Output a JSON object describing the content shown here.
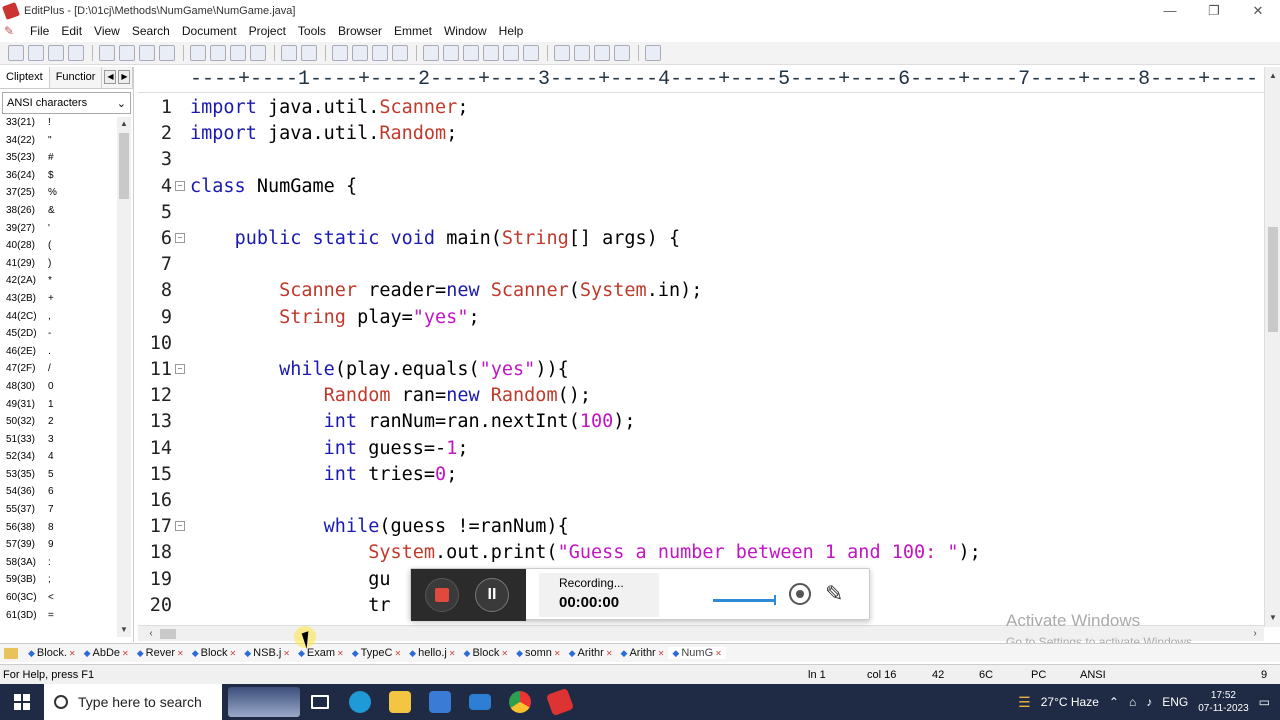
{
  "window": {
    "title": "EditPlus - [D:\\01cj\\Methods\\NumGame\\NumGame.java]",
    "min": "—",
    "max": "❐",
    "close": "✕"
  },
  "menu": [
    "File",
    "Edit",
    "View",
    "Search",
    "Document",
    "Project",
    "Tools",
    "Browser",
    "Emmet",
    "Window",
    "Help"
  ],
  "side": {
    "tabs": [
      "Cliptext",
      "Functior"
    ],
    "charset": "ANSI characters",
    "chars": [
      [
        "33(21)",
        "!"
      ],
      [
        "34(22)",
        "\""
      ],
      [
        "35(23)",
        "#"
      ],
      [
        "36(24)",
        "$"
      ],
      [
        "37(25)",
        "%"
      ],
      [
        "38(26)",
        "&"
      ],
      [
        "39(27)",
        "'"
      ],
      [
        "40(28)",
        "("
      ],
      [
        "41(29)",
        ")"
      ],
      [
        "42(2A)",
        "*"
      ],
      [
        "43(2B)",
        "+"
      ],
      [
        "44(2C)",
        ","
      ],
      [
        "45(2D)",
        "-"
      ],
      [
        "46(2E)",
        "."
      ],
      [
        "47(2F)",
        "/"
      ],
      [
        "48(30)",
        "0"
      ],
      [
        "49(31)",
        "1"
      ],
      [
        "50(32)",
        "2"
      ],
      [
        "51(33)",
        "3"
      ],
      [
        "52(34)",
        "4"
      ],
      [
        "53(35)",
        "5"
      ],
      [
        "54(36)",
        "6"
      ],
      [
        "55(37)",
        "7"
      ],
      [
        "56(38)",
        "8"
      ],
      [
        "57(39)",
        "9"
      ],
      [
        "58(3A)",
        ":"
      ],
      [
        "59(3B)",
        ";"
      ],
      [
        "60(3C)",
        "<"
      ],
      [
        "61(3D)",
        "="
      ]
    ]
  },
  "ruler": "----+----1----+----2----+----3----+----4----+----5----+----6----+----7----+----8----+----",
  "code": [
    {
      "n": "1",
      "fold": false,
      "html": "<span class='kw'>import</span> java.util.<span class='cls'>Scanner</span>;"
    },
    {
      "n": "2",
      "fold": false,
      "html": "<span class='kw'>import</span> java.util.<span class='cls'>Random</span>;"
    },
    {
      "n": "3",
      "fold": false,
      "html": ""
    },
    {
      "n": "4",
      "fold": true,
      "html": "<span class='kw'>class</span> NumGame {"
    },
    {
      "n": "5",
      "fold": false,
      "html": ""
    },
    {
      "n": "6",
      "fold": true,
      "html": "    <span class='kw'>public</span> <span class='kw'>static</span> <span class='kw'>void</span> main(<span class='cls'>String</span>[] args) {"
    },
    {
      "n": "7",
      "fold": false,
      "html": ""
    },
    {
      "n": "8",
      "fold": false,
      "html": "        <span class='cls'>Scanner</span> reader=<span class='kw'>new</span> <span class='cls'>Scanner</span>(<span class='cls'>System</span>.in);"
    },
    {
      "n": "9",
      "fold": false,
      "html": "        <span class='cls'>String</span> play=<span class='str'>\"yes\"</span>;"
    },
    {
      "n": "10",
      "fold": false,
      "html": ""
    },
    {
      "n": "11",
      "fold": true,
      "html": "        <span class='kw'>while</span>(play.equals(<span class='str'>\"yes\"</span>)){"
    },
    {
      "n": "12",
      "fold": false,
      "html": "            <span class='cls'>Random</span> ran=<span class='kw'>new</span> <span class='cls'>Random</span>();"
    },
    {
      "n": "13",
      "fold": false,
      "html": "            <span class='kw'>int</span> ranNum=ran.nextInt(<span class='num'>100</span>);"
    },
    {
      "n": "14",
      "fold": false,
      "html": "            <span class='kw'>int</span> guess=-<span class='num'>1</span>;"
    },
    {
      "n": "15",
      "fold": false,
      "html": "            <span class='kw'>int</span> tries=<span class='num'>0</span>;"
    },
    {
      "n": "16",
      "fold": false,
      "html": ""
    },
    {
      "n": "17",
      "fold": true,
      "html": "            <span class='kw'>while</span>(guess !=ranNum){"
    },
    {
      "n": "18",
      "fold": false,
      "html": "                <span class='cls'>System</span>.out.print(<span class='str'>\"Guess a number between 1 and 100: \"</span>);"
    },
    {
      "n": "19",
      "fold": false,
      "html": "                gu"
    },
    {
      "n": "20",
      "fold": false,
      "html": "                tr"
    }
  ],
  "watermark": {
    "line1": "Activate Windows",
    "line2": "Go to Settings to activate Windows."
  },
  "doctabs": [
    "Block.",
    "AbDe",
    "Rever",
    "Block",
    "NSB.j",
    "Exam",
    "TypeC",
    "hello.j",
    "Block",
    "somn",
    "Arithr",
    "Arithr",
    "NumG"
  ],
  "status": {
    "help": "For Help, press F1",
    "ln": "ln 1",
    "col": "col 16",
    "n42": "42",
    "hex": "6C",
    "pc": "PC",
    "enc": "ANSI",
    "nine": "9"
  },
  "recorder": {
    "label": "Recording...",
    "time": "00:00:00"
  },
  "taskbar": {
    "search_placeholder": "Type here to search",
    "weather": "27°C  Haze",
    "lang": "ENG",
    "time": "17:52",
    "date": "07-11-2023"
  }
}
